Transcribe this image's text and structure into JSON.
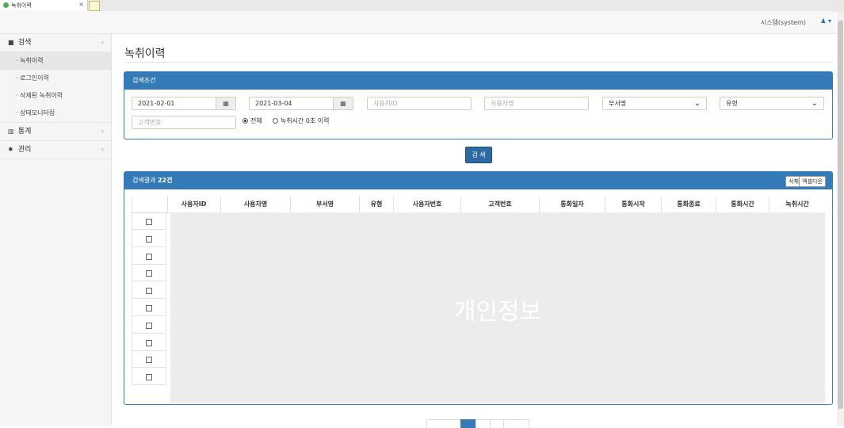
{
  "browser": {
    "tab_title": "녹취이력",
    "close_glyph": "×"
  },
  "header": {
    "user_name": "시스템(system)",
    "user_icon": "user-icon",
    "user_menu_glyph": "♟ ▾"
  },
  "sidebar": {
    "groups": [
      {
        "label": "검색",
        "icon": "briefcase-icon",
        "glyph": "■",
        "chevron": "‹",
        "items": [
          {
            "label": "· 녹취이력",
            "active": true
          },
          {
            "label": "· 로그인이력"
          },
          {
            "label": "· 삭제된 녹취이력"
          },
          {
            "label": "· 상태모니터링"
          }
        ]
      },
      {
        "label": "통계",
        "icon": "trash-icon",
        "glyph": "▥",
        "chevron": "‹"
      },
      {
        "label": "관리",
        "icon": "gear-icon",
        "glyph": "✸",
        "chevron": "‹"
      }
    ]
  },
  "main": {
    "page_title": "녹취이력"
  },
  "search": {
    "title": "검색조건",
    "start_date": "2021-02-01",
    "end_date": "2021-03-04",
    "calendar_glyph": "▦",
    "user_id_placeholder": "사용자ID",
    "user_name_placeholder": "사용자명",
    "dept_select": "부서명",
    "type_select": "유형",
    "customer_placeholder": "고객번호",
    "radio_all": "전체",
    "radio_zero": "녹취시간 0초 이력",
    "select_arrow": "⌄",
    "button_label": "검 색"
  },
  "results": {
    "title_prefix": "검색결과 ",
    "count": "22",
    "title_suffix": "건",
    "delete_label": "삭제",
    "excel_label": "엑셀다운",
    "columns": [
      "사용자ID",
      "사용자명",
      "부서명",
      "유형",
      "사용자번호",
      "고객번호",
      "통화일자",
      "통화시작",
      "통화종료",
      "통화시간",
      "녹취시간"
    ],
    "row_count": 10,
    "masked_text": "개인정보"
  },
  "pagination": {
    "active_page_index": 1
  }
}
